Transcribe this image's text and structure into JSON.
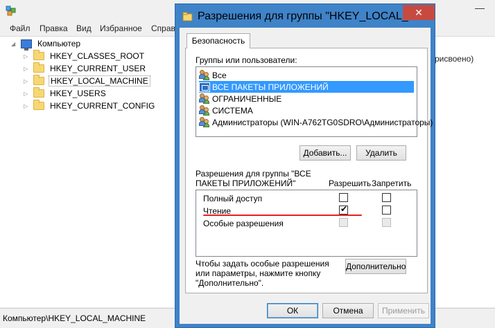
{
  "background": {
    "menu": [
      "Файл",
      "Правка",
      "Вид",
      "Избранное",
      "Справ"
    ],
    "tree": {
      "root": "Компьютер",
      "keys": [
        "HKEY_CLASSES_ROOT",
        "HKEY_CURRENT_USER",
        "HKEY_LOCAL_MACHINE",
        "HKEY_USERS",
        "HKEY_CURRENT_CONFIG"
      ]
    },
    "right_pane_text": "рисвоено)",
    "status": "Компьютер\\HKEY_LOCAL_MACHINE"
  },
  "dialog": {
    "title": "Разрешения для группы \"HKEY_LOCAL_MA",
    "close_symbol": "✕",
    "tab": "Безопасность",
    "groups_label": "Группы или пользователи:",
    "users": [
      {
        "name": "Все",
        "icon": "users-icon",
        "selected": false
      },
      {
        "name": "ВСЕ ПАКЕТЫ ПРИЛОЖЕНИЙ",
        "icon": "package-icon",
        "selected": true
      },
      {
        "name": "ОГРАНИЧЕННЫЕ",
        "icon": "users-icon",
        "selected": false
      },
      {
        "name": "СИСТЕМА",
        "icon": "users-icon",
        "selected": false
      },
      {
        "name": "Администраторы (WIN-A762TG0SDRO\\Администраторы)",
        "icon": "users-icon",
        "selected": false
      }
    ],
    "add_button": "Добавить...",
    "remove_button": "Удалить",
    "permissions_label": "Разрешения для группы \"ВСЕ ПАКЕТЫ ПРИЛОЖЕНИЙ\"",
    "allow_header": "Разрешить",
    "deny_header": "Запретить",
    "permissions": [
      {
        "name": "Полный доступ",
        "allow": false,
        "deny": false,
        "disabled": false
      },
      {
        "name": "Чтение",
        "allow": true,
        "deny": false,
        "disabled": false
      },
      {
        "name": "Особые разрешения",
        "allow": false,
        "deny": false,
        "disabled": true
      }
    ],
    "special_note": "Чтобы задать особые разрешения или параметры, нажмите кнопку \"Дополнительно\".",
    "advanced_button": "Дополнительно",
    "ok_button": "ОК",
    "cancel_button": "Отмена",
    "apply_button": "Применить"
  }
}
